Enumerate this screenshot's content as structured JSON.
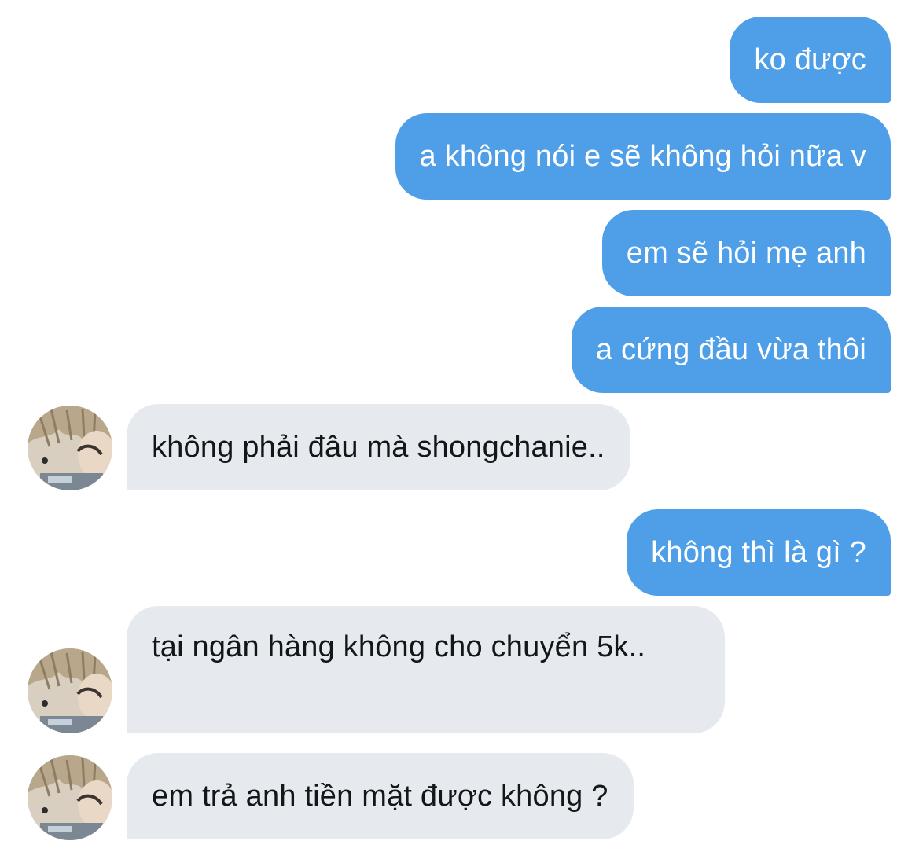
{
  "messages": [
    {
      "from": "me",
      "text": "ko được"
    },
    {
      "from": "me",
      "text": "a không nói e sẽ không hỏi nữa v"
    },
    {
      "from": "me",
      "text": "em sẽ hỏi mẹ anh"
    },
    {
      "from": "me",
      "text": "a cứng đầu vừa thôi"
    },
    {
      "from": "them",
      "text": "không phải đâu mà shongchanie.."
    },
    {
      "from": "me",
      "text": "không thì là gì ?"
    },
    {
      "from": "them",
      "text": "tại ngân hàng không cho chuyển 5k.."
    },
    {
      "from": "them",
      "text": "em trả anh tiền mặt được không ?"
    }
  ],
  "colors": {
    "sent_bubble": "#4e9ee8",
    "received_bubble": "#e6eaee",
    "sent_text": "#ffffff",
    "received_text": "#14171a"
  },
  "icons": {
    "avatar": "user-avatar-photo"
  }
}
